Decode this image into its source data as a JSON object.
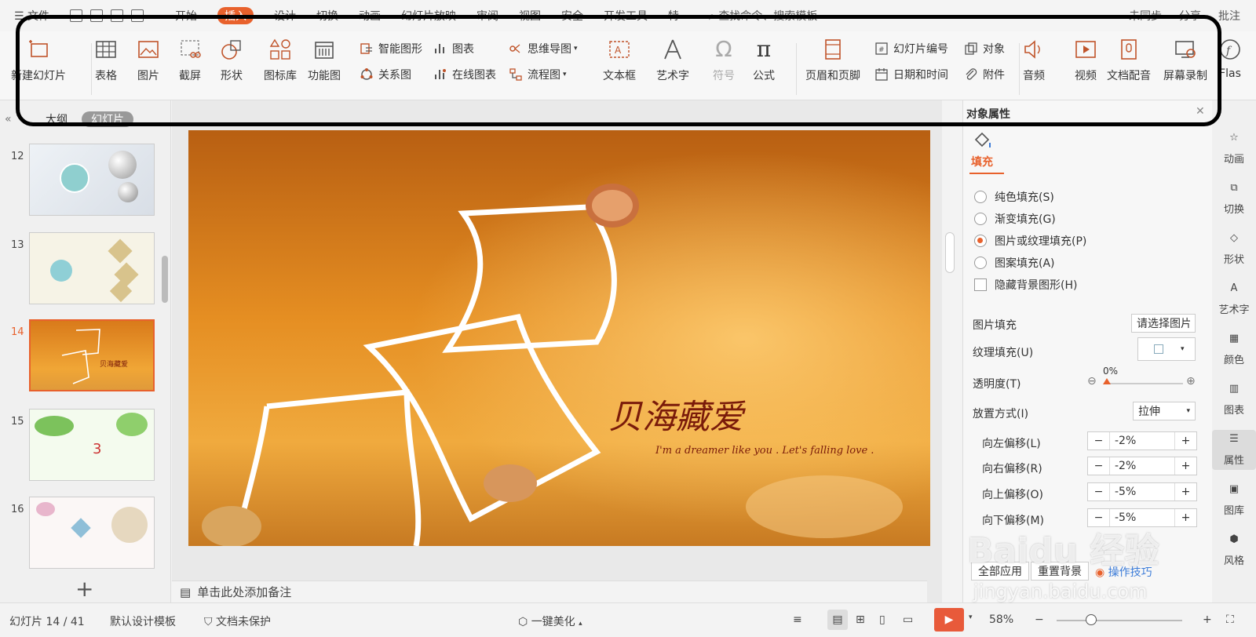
{
  "menu": {
    "items": [
      "文件",
      "开始",
      "插入",
      "设计",
      "切换",
      "动画",
      "幻灯片放映",
      "审阅",
      "视图",
      "安全",
      "开发工具",
      "特"
    ],
    "active_index": 2,
    "search": "查找命令、搜索模板",
    "right": [
      "未同步",
      "分享",
      "批注"
    ]
  },
  "ribbon": {
    "new_slide": "新建幻灯片",
    "table": "表格",
    "picture": "图片",
    "screenshot": "截屏",
    "shape": "形状",
    "icon_lib": "图标库",
    "func_chart": "功能图",
    "smart_art": "智能图形",
    "chart": "图表",
    "relation": "关系图",
    "online_chart": "在线图表",
    "mindmap": "思维导图",
    "flowchart": "流程图",
    "textbox": "文本框",
    "wordart": "艺术字",
    "symbol": "符号",
    "formula": "公式",
    "header_footer": "页眉和页脚",
    "slide_number": "幻灯片编号",
    "object": "对象",
    "datetime": "日期和时间",
    "attachment": "附件",
    "audio": "音频",
    "video": "视频",
    "doc_dub": "文档配音",
    "screen_rec": "屏幕录制",
    "flash": "Flas"
  },
  "left": {
    "tab_outline": "大纲",
    "tab_slides": "幻灯片",
    "slides": [
      {
        "num": "12"
      },
      {
        "num": "13"
      },
      {
        "num": "14"
      },
      {
        "num": "15"
      },
      {
        "num": "16"
      }
    ],
    "selected_num": "14"
  },
  "slide": {
    "title": "贝海藏爱",
    "subtitle": "I'm a dreamer like you . Let's falling love ."
  },
  "notes": "单击此处添加备注",
  "props": {
    "title": "对象属性",
    "tab_fill": "填充",
    "solid": "纯色填充(S)",
    "gradient": "渐变填充(G)",
    "picture": "图片或纹理填充(P)",
    "pattern": "图案填充(A)",
    "hide_bg": "隐藏背景图形(H)",
    "pic_fill_label": "图片填充",
    "pic_fill_value": "请选择图片",
    "texture_label": "纹理填充(U)",
    "opacity_label": "透明度(T)",
    "opacity_value": "0%",
    "placement_label": "放置方式(I)",
    "placement_value": "拉伸",
    "offset_left_label": "向左偏移(L)",
    "offset_left": "-2%",
    "offset_right_label": "向右偏移(R)",
    "offset_right": "-2%",
    "offset_up_label": "向上偏移(O)",
    "offset_up": "-5%",
    "offset_down_label": "向下偏移(M)",
    "offset_down": "-5%",
    "apply_all": "全部应用",
    "reset_bg": "重置背景",
    "tips": "操作技巧"
  },
  "side": [
    "动画",
    "切换",
    "形状",
    "艺术字",
    "颜色",
    "图表",
    "属性",
    "图库",
    "风格"
  ],
  "status": {
    "slide_pos": "幻灯片 14 / 41",
    "template": "默认设计模板",
    "protect": "文档未保护",
    "beautify": "一键美化",
    "zoom": "58%"
  },
  "watermark": {
    "brand": "Baidu 经验",
    "url": "jingyan.baidu.com"
  },
  "colors": {
    "accent": "#e8612c"
  }
}
